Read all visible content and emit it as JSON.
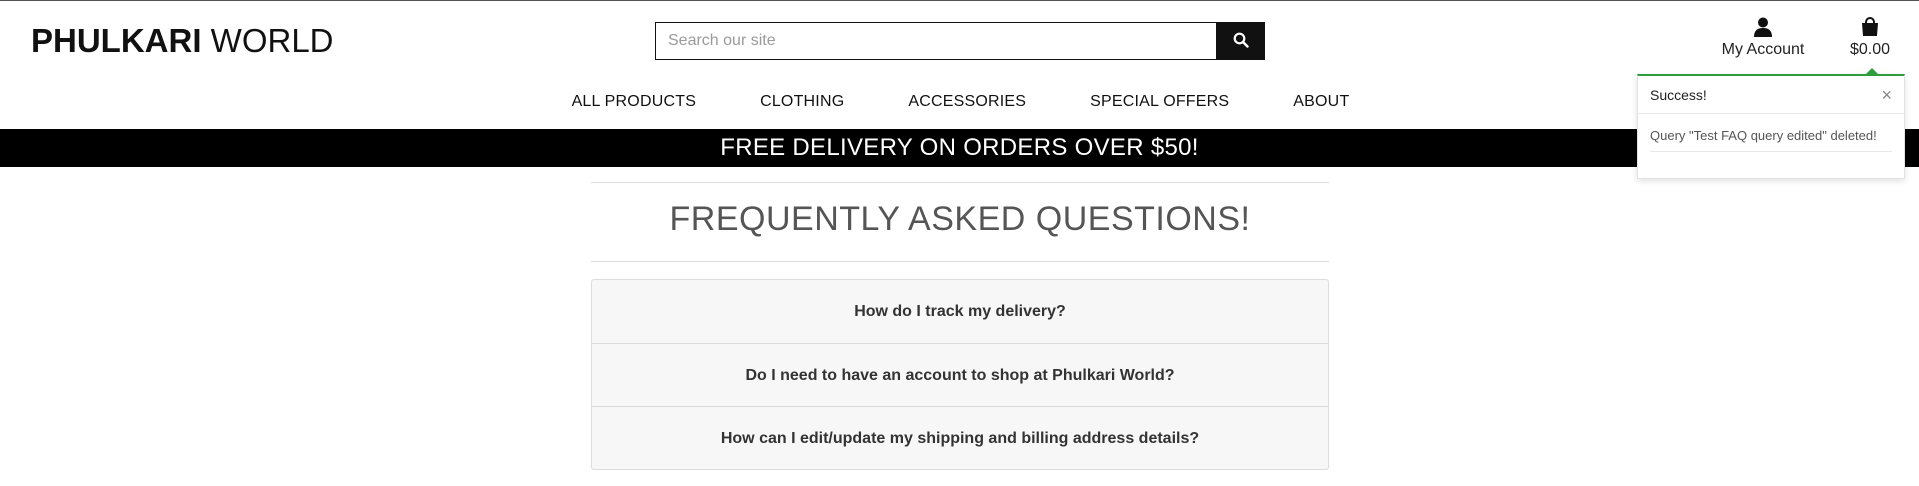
{
  "brand": {
    "logo_bold": "PHULKARI",
    "logo_light": " WORLD"
  },
  "search": {
    "placeholder": "Search our site",
    "value": "",
    "icon": "search-icon"
  },
  "account": {
    "label": "My Account",
    "icon": "user-icon"
  },
  "bag": {
    "total": "$0.00",
    "icon": "shopping-bag-icon"
  },
  "nav": {
    "items": [
      {
        "label": "ALL PRODUCTS"
      },
      {
        "label": "CLOTHING"
      },
      {
        "label": "ACCESSORIES"
      },
      {
        "label": "SPECIAL OFFERS"
      },
      {
        "label": "ABOUT"
      }
    ]
  },
  "banner": {
    "text": "FREE DELIVERY ON ORDERS OVER $50!"
  },
  "faq": {
    "title": "FREQUENTLY ASKED QUESTIONS!",
    "questions": [
      {
        "label": "How do I track my delivery?"
      },
      {
        "label": "Do I need to have an account to shop at Phulkari World?"
      },
      {
        "label": "How can I edit/update my shipping and billing address details?"
      }
    ]
  },
  "toast": {
    "title": "Success!",
    "close": "×",
    "message": "Query \"Test FAQ query edited\" deleted!",
    "accent": "#2e9b3c"
  }
}
